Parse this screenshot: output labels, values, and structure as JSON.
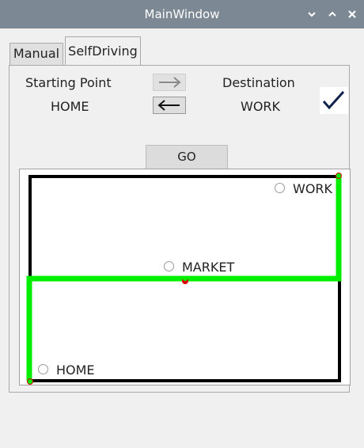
{
  "window": {
    "title": "MainWindow"
  },
  "tabs": {
    "manual": "Manual",
    "self_driving": "SelfDriving"
  },
  "route": {
    "starting_point_label": "Starting Point",
    "destination_label": "Destination",
    "start_value": "HOME",
    "destination_value": "WORK"
  },
  "actions": {
    "go_label": "GO"
  },
  "map": {
    "places": {
      "work": "WORK",
      "market": "MARKET",
      "home": "HOME"
    },
    "colors": {
      "road": "#000000",
      "route": "#00ee00",
      "node": "#dd0000"
    }
  },
  "icons": {
    "minimize": "chevron-down-icon",
    "maximize": "chevron-up-icon",
    "close": "close-icon",
    "forward": "arrow-right-icon",
    "backward": "arrow-left-icon",
    "confirm": "checkmark-icon"
  }
}
